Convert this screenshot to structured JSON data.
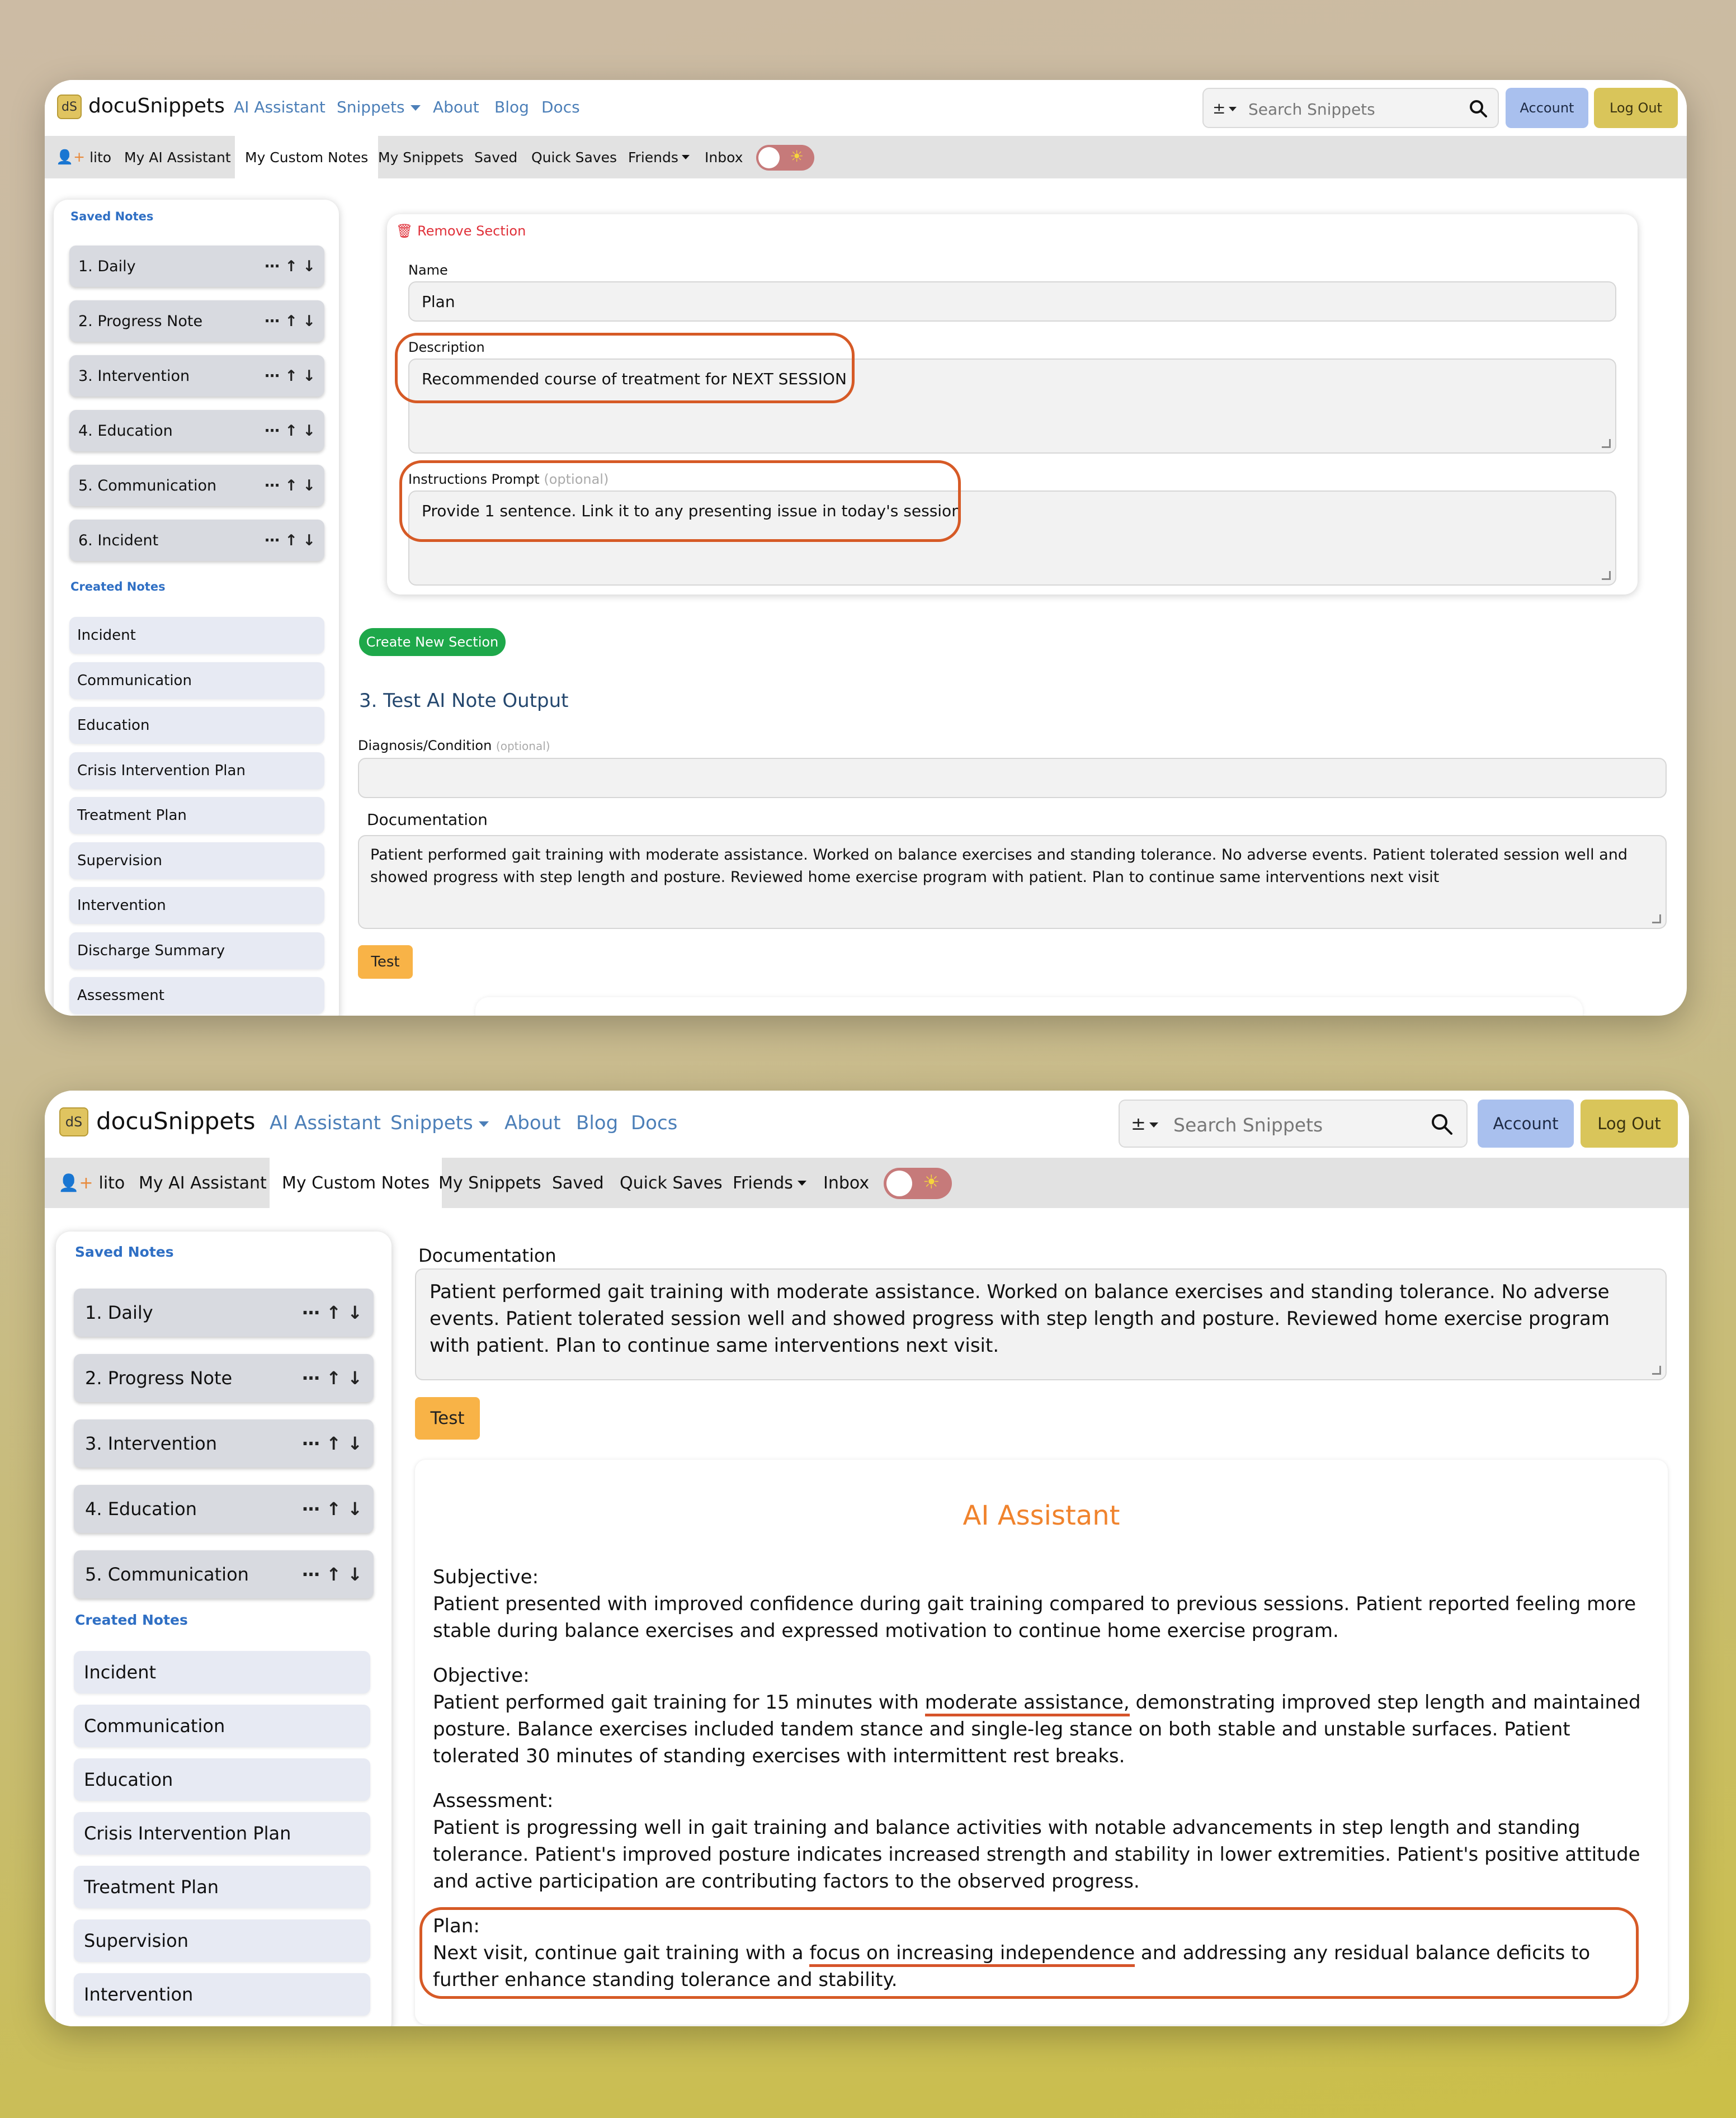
{
  "brand": {
    "logo": "dS",
    "name": "docuSnippets"
  },
  "nav": {
    "links": [
      "AI Assistant",
      "Snippets",
      "About",
      "Blog",
      "Docs"
    ]
  },
  "search": {
    "placeholder": "Search Snippets",
    "filter_icon": "±",
    "search_icon": "search-icon"
  },
  "buttons": {
    "account": "Account",
    "logout": "Log Out"
  },
  "subnav": {
    "user": "lito",
    "items": [
      "My AI Assistant",
      "My Custom Notes",
      "My Snippets",
      "Saved",
      "Quick Saves",
      "Friends",
      "Inbox"
    ],
    "active": "My Custom Notes"
  },
  "sidebar": {
    "saved_heading": "Saved Notes",
    "saved": [
      "1. Daily",
      "2. Progress Note",
      "3. Intervention",
      "4. Education",
      "5. Communication",
      "6. Incident"
    ],
    "created_heading": "Created Notes",
    "created": [
      "Incident",
      "Communication",
      "Education",
      "Crisis Intervention Plan",
      "Treatment Plan",
      "Supervision",
      "Intervention",
      "Discharge Summary",
      "Assessment"
    ],
    "controls": "⋯ ↑ ↓"
  },
  "section": {
    "remove": "Remove Section",
    "name_label": "Name",
    "name_value": "Plan",
    "description_label": "Description",
    "description_value": "Recommended course of treatment for NEXT SESSION",
    "prompt_label": "Instructions Prompt",
    "prompt_optional": "(optional)",
    "prompt_value": "Provide 1 sentence. Link it to any presenting issue in today's session"
  },
  "create_section": "Create New Section",
  "test_heading": "3. Test AI Note Output",
  "diagnosis": {
    "label": "Diagnosis/Condition",
    "optional": "(optional)"
  },
  "documentation": {
    "label": "Documentation",
    "value_1": "Patient performed gait training with moderate assistance. Worked on balance exercises and standing tolerance. No adverse events. Patient tolerated session well and showed progress with step length and posture. Reviewed home exercise program with patient. Plan to continue same interventions next visit",
    "value_2": "Patient performed gait training with moderate assistance. Worked on balance exercises and standing tolerance. No adverse events. Patient tolerated session well and showed progress with step length and posture. Reviewed home exercise program with patient. Plan to continue same interventions next visit."
  },
  "test_button": "Test",
  "ai": {
    "title": "AI Assistant",
    "subjective_h": "Subjective:",
    "subjective": "Patient presented with improved confidence during gait training compared to previous sessions. Patient reported feeling more stable during balance exercises and expressed motivation to continue home exercise program.",
    "objective_h": "Objective:",
    "objective_pre": "Patient performed gait training for 15 minutes with ",
    "objective_hl": "moderate assistance,",
    "objective_post": " demonstrating improved step length and maintained posture. Balance exercises included tandem stance and single-leg stance on both stable and unstable surfaces. Patient tolerated 30 minutes of standing exercises with intermittent rest breaks.",
    "assessment_h": "Assessment:",
    "assessment": "Patient is progressing well in gait training and balance activities with notable advancements in step length and standing tolerance. Patient's improved posture indicates increased strength and stability in lower extremities. Patient's positive attitude and active participation are contributing factors to the observed progress.",
    "plan_h": "Plan:",
    "plan_pre": "Next visit, continue gait training with a ",
    "plan_hl": "focus on increasing independence",
    "plan_post": " and addressing any residual balance deficits to further enhance standing tolerance and stability."
  },
  "colors": {
    "accent": "#4c7fb8",
    "annotation": "#d65a26",
    "ai_title": "#f0832d",
    "green": "#1ea84a"
  }
}
